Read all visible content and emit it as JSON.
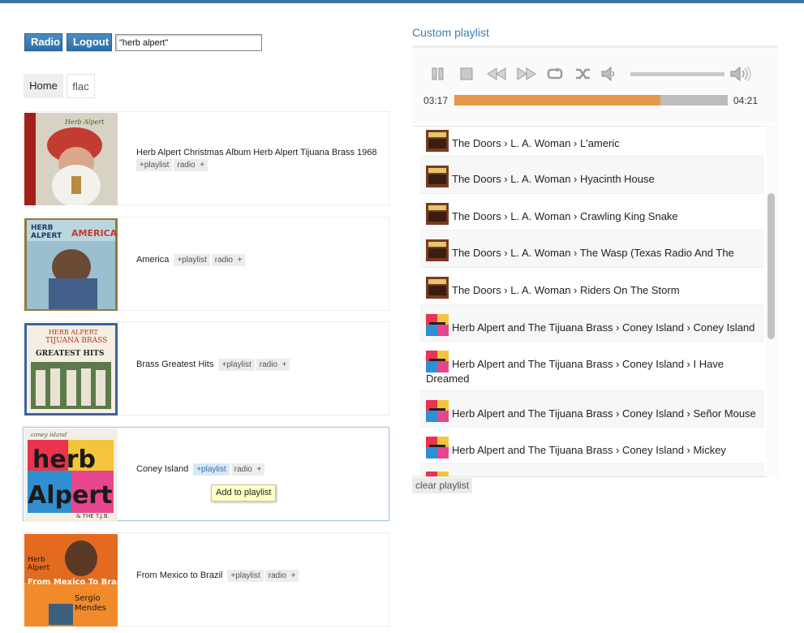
{
  "header": {
    "radio_button": "Radio",
    "logout_button": "Logout",
    "search_value": "\"herb alpert\""
  },
  "tabs": {
    "home": "Home",
    "flac": "flac"
  },
  "albums": [
    {
      "title": "Herb Alpert Christmas Album Herb Alpert Tijuana Brass 1968",
      "add": "+playlist",
      "radio": "radio",
      "plus": "+"
    },
    {
      "title": "America",
      "add": "+playlist",
      "radio": "radio",
      "plus": "+"
    },
    {
      "title": "Brass Greatest Hits",
      "add": "+playlist",
      "radio": "radio",
      "plus": "+"
    },
    {
      "title": "Coney Island",
      "add": "+playlist",
      "radio": "radio",
      "plus": "+"
    },
    {
      "title": "From Mexico to Brazil",
      "add": "+playlist",
      "radio": "radio",
      "plus": "+"
    }
  ],
  "tooltip": "Add to playlist",
  "playlist": {
    "title": "Custom playlist",
    "elapsed": "03:17",
    "total": "04:21",
    "progress_fraction": 0.755,
    "clear_button": "clear playlist",
    "items": [
      {
        "text": "The Doors › L. A. Woman › L'americ"
      },
      {
        "text": "The Doors › L. A. Woman › Hyacinth House"
      },
      {
        "text": "The Doors › L. A. Woman › Crawling King Snake"
      },
      {
        "text": "The Doors › L. A. Woman › The Wasp (Texas Radio And The"
      },
      {
        "text": "The Doors › L. A. Woman › Riders On The Storm"
      },
      {
        "text": "Herb Alpert and The Tijuana Brass › Coney Island › Coney Island"
      },
      {
        "text": "Herb Alpert and The Tijuana Brass › Coney Island › I Have Dreamed"
      },
      {
        "text": "Herb Alpert and The Tijuana Brass › Coney Island › Señor Mouse"
      },
      {
        "text": "Herb Alpert and The Tijuana Brass › Coney Island › Mickey"
      }
    ]
  },
  "icons": {
    "controls": [
      "pause-icon",
      "stop-icon",
      "rewind-icon",
      "fast-forward-icon",
      "repeat-icon",
      "shuffle-icon",
      "volume-low-icon",
      "volume-high-icon"
    ]
  },
  "colors": {
    "accent": "#3a7fbb",
    "button": "#2f6fa8",
    "progress": "#e8964a",
    "tooltip_bg": "#ffffc6"
  }
}
